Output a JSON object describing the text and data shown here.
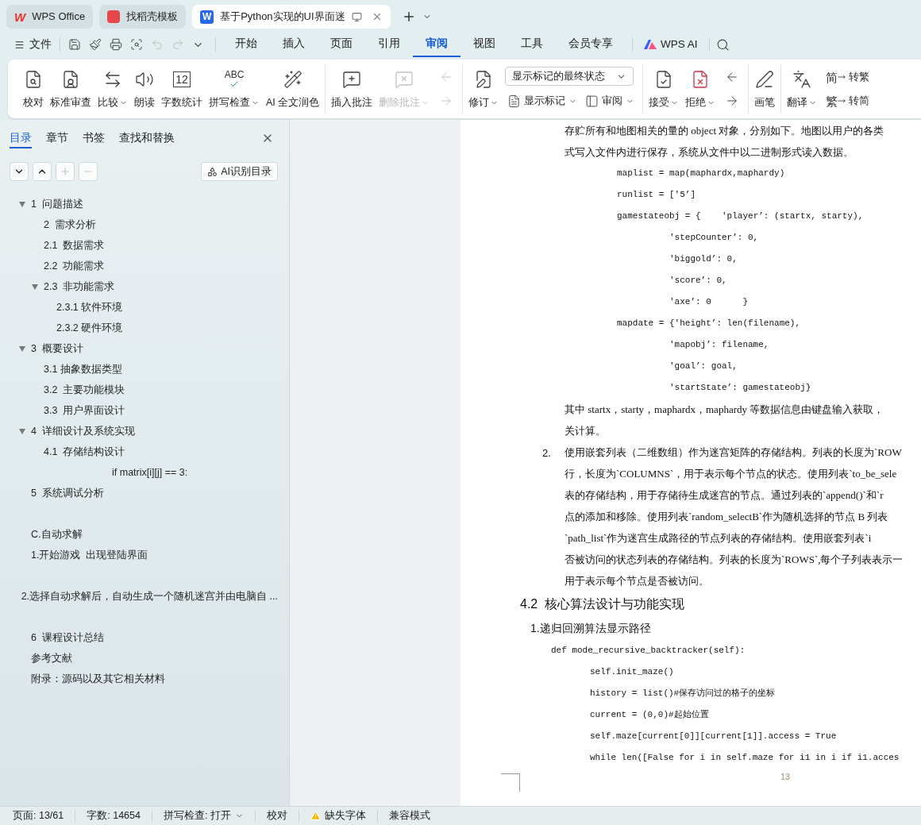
{
  "tabs": [
    {
      "kind": "home",
      "logo": "W",
      "label": "WPS Office",
      "selected": false
    },
    {
      "kind": "template",
      "label": "找稻壳模板",
      "selected": false
    },
    {
      "kind": "document",
      "logo": "W",
      "label": "基于Python实现的UI界面迷",
      "selected": true
    }
  ],
  "menu": {
    "file": "文件",
    "undo_disabled": true,
    "redo_disabled": true,
    "tabs": [
      {
        "label": "开始",
        "selected": false
      },
      {
        "label": "插入",
        "selected": false
      },
      {
        "label": "页面",
        "selected": false
      },
      {
        "label": "引用",
        "selected": false
      },
      {
        "label": "审阅",
        "selected": true
      },
      {
        "label": "视图",
        "selected": false
      },
      {
        "label": "工具",
        "selected": false
      },
      {
        "label": "会员专享",
        "selected": false
      }
    ],
    "ai": "WPS AI"
  },
  "ribbon": {
    "groups": [
      {
        "items": [
          {
            "kind": "large",
            "label": "校对"
          },
          {
            "kind": "large",
            "label": "标准审查"
          },
          {
            "kind": "large",
            "label": "比较",
            "has_menu": true
          },
          {
            "kind": "large",
            "label": "朗读"
          },
          {
            "kind": "large",
            "label": "字数统计",
            "glyph": "12"
          },
          {
            "kind": "large",
            "label": "拼写检查",
            "glyph": "ABC",
            "has_menu": true
          },
          {
            "kind": "large",
            "label": "AI 全文润色"
          }
        ]
      },
      {
        "items": [
          {
            "kind": "large",
            "label": "插入批注"
          },
          {
            "kind": "large",
            "label": "删除批注",
            "has_menu": true,
            "disabled": true
          },
          {
            "kind": "stack",
            "rows": [
              [
                {
                  "kind": "icon",
                  "disabled": true
                }
              ],
              [
                {
                  "kind": "icon",
                  "disabled": true
                }
              ]
            ]
          }
        ]
      },
      {
        "items": [
          {
            "kind": "large",
            "label": "修订",
            "has_menu": true
          },
          {
            "kind": "stack",
            "rows": [
              [
                {
                  "kind": "select",
                  "value": "显示标记的最终状态"
                }
              ],
              [
                {
                  "kind": "small",
                  "label": "显示标记",
                  "has_menu": true
                },
                {
                  "kind": "small",
                  "label": "审阅",
                  "has_menu": true
                }
              ]
            ]
          }
        ]
      },
      {
        "items": [
          {
            "kind": "large",
            "label": "接受",
            "has_menu": true
          },
          {
            "kind": "large",
            "label": "拒绝",
            "has_menu": true
          },
          {
            "kind": "stack",
            "rows": [
              [
                {
                  "kind": "icon",
                  "disabled": false
                }
              ],
              [
                {
                  "kind": "icon",
                  "disabled": false
                }
              ]
            ]
          }
        ]
      },
      {
        "items": [
          {
            "kind": "large",
            "label": "画笔"
          }
        ]
      },
      {
        "items": [
          {
            "kind": "large",
            "label": "翻译",
            "has_menu": true
          },
          {
            "kind": "stack",
            "rows": [
              [
                {
                  "kind": "small",
                  "label": "转繁",
                  "glyph": "简"
                }
              ],
              [
                {
                  "kind": "small",
                  "label": "转简",
                  "glyph": "繁"
                }
              ]
            ]
          }
        ]
      }
    ]
  },
  "outline": {
    "tabs": [
      {
        "label": "目录",
        "selected": true
      },
      {
        "label": "章节",
        "selected": false
      },
      {
        "label": "书签",
        "selected": false
      },
      {
        "label": "查找和替换",
        "selected": false
      }
    ],
    "buttons": [
      {
        "disabled": false
      },
      {
        "disabled": false
      },
      {
        "disabled": true
      },
      {
        "disabled": true
      }
    ],
    "ai_button": "AI识别目录",
    "groups": [
      {
        "items": [
          {
            "label": "1  问题描述",
            "expanded": true,
            "children": [
              {
                "label": "2  需求分析"
              },
              {
                "label": "2.1  数据需求"
              },
              {
                "label": "2.2  功能需求"
              },
              {
                "label": "2.3  非功能需求",
                "expanded": true,
                "children": [
                  {
                    "label": "2.3.1 软件环境"
                  },
                  {
                    "label": "2.3.2 硬件环境"
                  }
                ]
              }
            ]
          },
          {
            "label": "3  概要设计",
            "expanded": true,
            "children": [
              {
                "label": "3.1 抽象数据类型"
              },
              {
                "label": "3.2  主要功能模块"
              },
              {
                "label": "3.3  用户界面设计"
              }
            ]
          },
          {
            "label": "4  详细设计及系统实现",
            "expanded": true,
            "children": [
              {
                "label": "4.1  存储结构设计"
              },
              {
                "label": "if matrix[i][j] == 3:",
                "kind": "code"
              }
            ]
          },
          {
            "label": "5  系统调试分析"
          }
        ]
      },
      {
        "items": [
          {
            "label": "C.自动求解"
          },
          {
            "label": "1.开始游戏  出现登陆界面"
          }
        ]
      },
      {
        "items": [
          {
            "label": "2.选择自动求解后，自动生成一个随机迷宫并由电脑自 ..."
          }
        ]
      },
      {
        "items": [
          {
            "label": "6  课程设计总结"
          },
          {
            "label": "参考文献"
          },
          {
            "label": "附录：源码以及其它相关材料"
          }
        ]
      }
    ]
  },
  "document": {
    "blocks": [
      {
        "kind": "para",
        "text": "存贮所有和地图相关的量的 object 对象，分别如下。地图以用户的各类"
      },
      {
        "kind": "para",
        "text": "式写入文件内进行保存，系统从文件中以二进制形式读入数据。"
      },
      {
        "kind": "code",
        "text": "maplist = map(maphardx,maphardy)"
      },
      {
        "kind": "code",
        "text": "runlist = ['5’]"
      },
      {
        "kind": "code",
        "text": "gamestateobj = {    'player’: (startx, starty),",
        "children": [
          {
            "text": "'stepCounter’: 0,"
          },
          {
            "text": "'biggold’: 0,"
          },
          {
            "text": "'score’: 0,"
          },
          {
            "text": "'axe’: 0      }"
          }
        ]
      },
      {
        "kind": "code",
        "text": "mapdate = {'height’: len(filename),",
        "children": [
          {
            "text": "'mapobj’: filename,"
          },
          {
            "text": "'goal’: goal,"
          },
          {
            "text": "'startState’: gamestateobj}"
          }
        ]
      },
      {
        "kind": "para",
        "text": "其中 startx，starty，maphardx，maphardy 等数据信息由键盘输入获取，"
      },
      {
        "kind": "para",
        "text": "关计算。"
      },
      {
        "kind": "item",
        "marker": "2.",
        "lines": [
          "使用嵌套列表（二维数组）作为迷宫矩阵的存储结构。列表的长度为`ROW",
          "行，长度为`COLUMNS`，用于表示每个节点的状态。使用列表`to_be_sele",
          "表的存储结构，用于存储待生成迷宫的节点。通过列表的`append()`和`r",
          "点的添加和移除。使用列表`random_selectB`作为随机选择的节点 B 列表",
          "`path_list`作为迷宫生成路径的节点列表的存储结构。使用嵌套列表`i",
          "否被访问的状态列表的存储结构。列表的长度为`ROWS`,每个子列表表示一",
          "用于表示每个节点是否被访问。"
        ]
      },
      {
        "kind": "heading",
        "text": "4.2  核心算法设计与功能实现"
      },
      {
        "kind": "subheading",
        "text": "1.递归回溯算法显示路径"
      },
      {
        "kind": "listing",
        "text": "def mode_recursive_backtracker(self):",
        "children": [
          {
            "text": "self.init_maze()"
          },
          {
            "text": "history = list()#保存访问过的格子的坐标"
          },
          {
            "text": "current = (0,0)#起始位置"
          },
          {
            "text": "self.maze[current[0]][current[1]].access = True"
          },
          {
            "text": "while len([False for i in self.maze for i1 in i if i1.acces"
          }
        ]
      }
    ],
    "page_number": "13"
  },
  "status_bar": [
    {
      "kind": "text",
      "label": "页面: 13/61"
    },
    {
      "kind": "text",
      "label": "字数: 14654"
    },
    {
      "kind": "text",
      "label": "拼写检查: 打开",
      "has_menu": true
    },
    {
      "kind": "text",
      "label": "校对"
    },
    {
      "kind": "warning",
      "label": "缺失字体"
    },
    {
      "kind": "text",
      "label": "兼容模式"
    }
  ]
}
